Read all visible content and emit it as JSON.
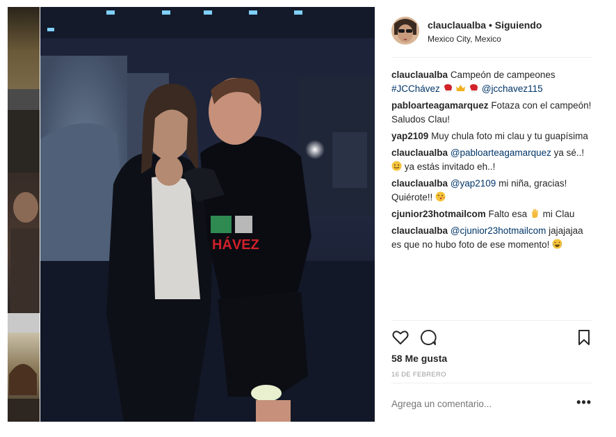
{
  "post": {
    "username": "clauclaualba",
    "separator": "•",
    "follow_status": "Siguiendo",
    "location": "Mexico City, Mexico"
  },
  "comments": [
    {
      "user": "clauclaualba",
      "text": "Campeón de campeones",
      "hashtag": "#JCChávez",
      "mention": "@jcchavez115"
    },
    {
      "user": "pabloarteagamarquez",
      "text": "Fotaza con el campeón! Saludos Clau!"
    },
    {
      "user": "yap2109",
      "text": "Muy chula foto mi clau y tu guapísima"
    },
    {
      "user": "clauclaualba",
      "mention": "@pabloarteagamarquez",
      "text_a": "ya sé..!",
      "text_b": "ya estás invitado eh..!"
    },
    {
      "user": "clauclaualba",
      "mention": "@yap2109",
      "text_a": "mi niña, gracias! Quiérote!!"
    },
    {
      "user": "cjunior23hotmailcom",
      "text_a": "Falto esa",
      "text_b": "mi Clau"
    },
    {
      "user": "clauclaualba",
      "mention": "@cjunior23hotmailcom",
      "text_a": "jajajajaa es que no hubo foto de ese momento!"
    }
  ],
  "icons": {
    "like": "heart-icon",
    "comment": "comment-bubble-icon",
    "save": "bookmark-icon",
    "more": "more-options-icon"
  },
  "likes": "58 Me gusta",
  "date": "16 DE FEBRERO",
  "comment_input": {
    "placeholder": "Agrega un comentario..."
  },
  "more_label": "•••"
}
